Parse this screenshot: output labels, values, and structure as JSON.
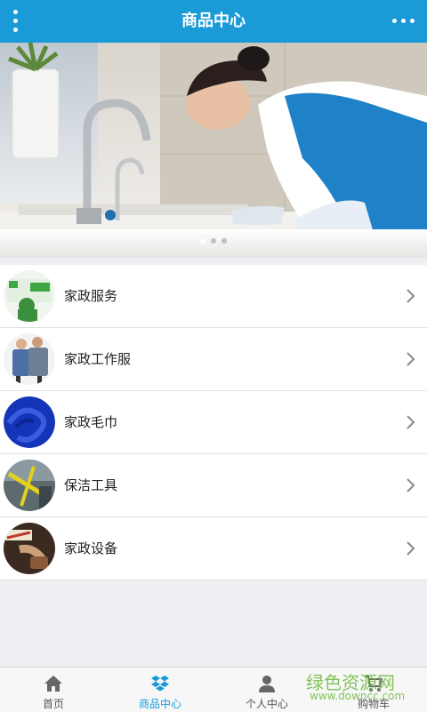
{
  "header": {
    "title": "商品中心",
    "menu_icon": "vertical-dots-icon",
    "more_icon": "horizontal-dots-icon",
    "bg_color": "#1a9bd7"
  },
  "banner": {
    "slides_total": 3,
    "active_slide": 1
  },
  "categories": [
    {
      "label": "家政服务",
      "thumb": "cleaning-service-thumb"
    },
    {
      "label": "家政工作服",
      "thumb": "workwear-thumb"
    },
    {
      "label": "家政毛巾",
      "thumb": "towel-thumb"
    },
    {
      "label": "保洁工具",
      "thumb": "cleaning-tools-thumb"
    },
    {
      "label": "家政设备",
      "thumb": "equipment-thumb"
    }
  ],
  "tabbar": {
    "active_color": "#1a9bd7",
    "tabs": [
      {
        "label": "首页",
        "icon": "home-icon"
      },
      {
        "label": "商品中心",
        "icon": "dropbox-icon",
        "active": true
      },
      {
        "label": "个人中心",
        "icon": "user-icon"
      },
      {
        "label": "购物车",
        "icon": "cart-icon"
      }
    ]
  },
  "watermark": {
    "line1": "绿色资源网",
    "line2": "www.downcc.com"
  }
}
